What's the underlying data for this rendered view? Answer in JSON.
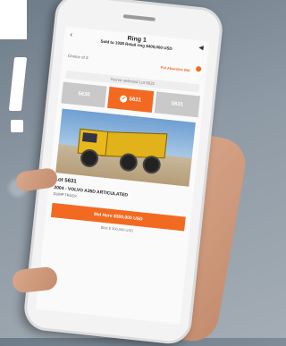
{
  "app": {
    "title": "Ring 1",
    "subtitle": "Sold to 1938 Retail ring $400,000 USD"
  },
  "auction": {
    "choice_label": "Choice of 3",
    "absentee_label": "Put Absentee Bid",
    "notice": "You've selected Lot 5631"
  },
  "lots": [
    {
      "label": "5630",
      "active": false
    },
    {
      "label": "5631",
      "active": true
    },
    {
      "label": "5631",
      "active": false
    }
  ],
  "item": {
    "lot_number": "Lot 5631",
    "description": "2004 - VOLVO A35D ARTICULATED",
    "subtitle": "DUMP TRUCK"
  },
  "bid": {
    "button_label": "Bid Here $300,000 USD",
    "amount_note": "Bids $ 300,000 USD"
  },
  "overlay": {
    "exclamation": "!"
  },
  "colors": {
    "accent": "#f26a21",
    "truck": "#e2b21a"
  }
}
